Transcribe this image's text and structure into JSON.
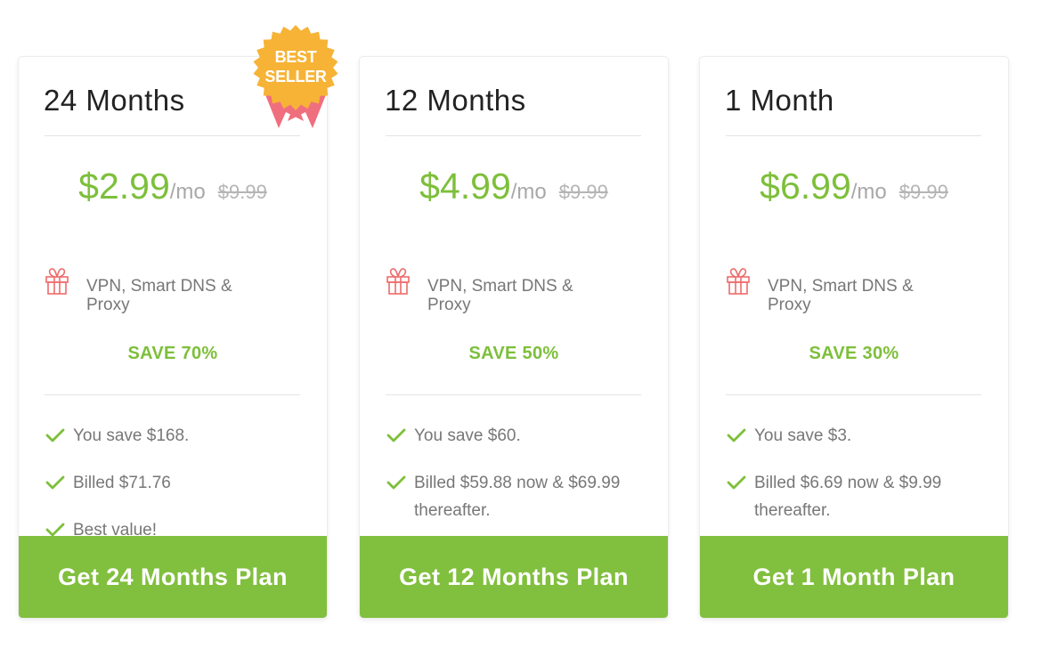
{
  "badge": {
    "line1": "BEST",
    "line2": "SELLER"
  },
  "colors": {
    "accent_green": "#7dbf3a",
    "button_green": "#81bf3e",
    "badge_orange": "#f6b336",
    "ribbon_pink": "#f06f7e",
    "gift_red": "#ee6b6b"
  },
  "plans": [
    {
      "title": "24 Months",
      "price": "$2.99",
      "per": "/mo",
      "old_price": "$9.99",
      "feature": "VPN, Smart DNS & Proxy",
      "feature_icon": "gift-icon",
      "save": "SAVE 70%",
      "benefits": [
        "You save $168.",
        "Billed $71.76",
        "Best value!"
      ],
      "cta": "Get 24 Months Plan"
    },
    {
      "title": "12 Months",
      "price": "$4.99",
      "per": "/mo",
      "old_price": "$9.99",
      "feature": "VPN, Smart DNS & Proxy",
      "feature_icon": "gift-icon",
      "save": "SAVE 50%",
      "benefits": [
        "You save $60.",
        "Billed $59.88 now & $69.99 thereafter."
      ],
      "cta": "Get 12 Months Plan"
    },
    {
      "title": "1 Month",
      "price": "$6.99",
      "per": "/mo",
      "old_price": "$9.99",
      "feature": "VPN, Smart DNS & Proxy",
      "feature_icon": "gift-icon",
      "save": "SAVE 30%",
      "benefits": [
        "You save $3.",
        "Billed $6.69 now & $9.99 thereafter."
      ],
      "cta": "Get 1 Month Plan"
    }
  ]
}
